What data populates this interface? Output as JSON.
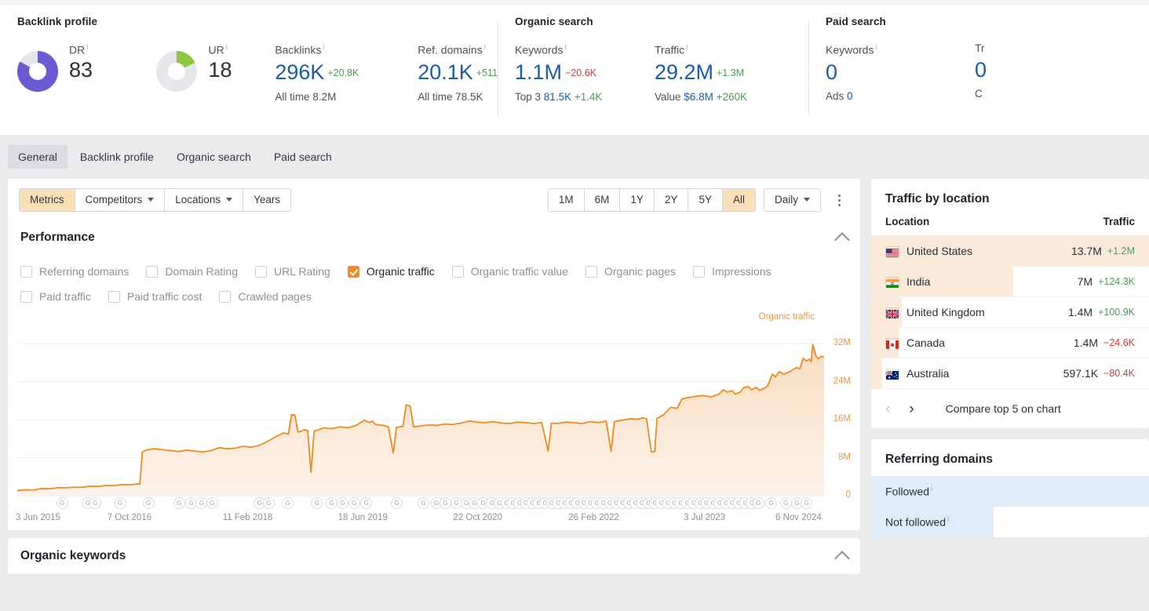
{
  "header": {
    "groups": [
      {
        "title": "Backlink profile",
        "gauges": [
          {
            "label": "DR",
            "value": "83",
            "pct": 83,
            "color": "#6b5bd2"
          },
          {
            "label": "UR",
            "value": "18",
            "pct": 18,
            "color": "#8cc63e"
          }
        ],
        "metrics": [
          {
            "label": "Backlinks",
            "value": "296K",
            "delta": "+20.8K",
            "delta_dir": "up",
            "sub_label": "All time",
            "sub_value": "8.2M"
          },
          {
            "label": "Ref. domains",
            "value": "20.1K",
            "delta": "+511",
            "delta_dir": "up",
            "sub_label": "All time",
            "sub_value": "78.5K"
          }
        ]
      },
      {
        "title": "Organic search",
        "metrics": [
          {
            "label": "Keywords",
            "value": "1.1M",
            "delta": "−20.6K",
            "delta_dir": "down",
            "sub_label": "Top 3",
            "sub_value": "81.5K",
            "sub_delta": "+1.4K",
            "sub_delta_dir": "up"
          },
          {
            "label": "Traffic",
            "value": "29.2M",
            "delta": "+1.3M",
            "delta_dir": "up",
            "sub_label": "Value",
            "sub_value": "$6.8M",
            "sub_delta": "+260K",
            "sub_delta_dir": "up"
          }
        ]
      },
      {
        "title": "Paid search",
        "metrics": [
          {
            "label": "Keywords",
            "value": "0",
            "sub_label": "Ads",
            "sub_value": "0"
          },
          {
            "label": "Tr",
            "value": "0",
            "sub_label": "C",
            "sub_value": ""
          }
        ]
      }
    ]
  },
  "tabs": [
    {
      "label": "General",
      "active": true
    },
    {
      "label": "Backlink profile",
      "active": false
    },
    {
      "label": "Organic search",
      "active": false
    },
    {
      "label": "Paid search",
      "active": false
    }
  ],
  "toolbar": {
    "left_buttons": [
      {
        "label": "Metrics",
        "selected": true,
        "caret": false
      },
      {
        "label": "Competitors",
        "selected": false,
        "caret": true
      },
      {
        "label": "Locations",
        "selected": false,
        "caret": true
      },
      {
        "label": "Years",
        "selected": false,
        "caret": false
      }
    ],
    "ranges": [
      {
        "label": "1M",
        "selected": false
      },
      {
        "label": "6M",
        "selected": false
      },
      {
        "label": "1Y",
        "selected": false
      },
      {
        "label": "2Y",
        "selected": false
      },
      {
        "label": "5Y",
        "selected": false
      },
      {
        "label": "All",
        "selected": true
      }
    ],
    "granularity": "Daily",
    "more_menu": "more-options"
  },
  "performance": {
    "title": "Performance",
    "metrics_row1": [
      {
        "label": "Referring domains",
        "checked": false
      },
      {
        "label": "Domain Rating",
        "checked": false
      },
      {
        "label": "URL Rating",
        "checked": false
      },
      {
        "label": "Organic traffic",
        "checked": true
      },
      {
        "label": "Organic traffic value",
        "checked": false
      },
      {
        "label": "Organic pages",
        "checked": false
      },
      {
        "label": "Impressions",
        "checked": false
      }
    ],
    "metrics_row2": [
      {
        "label": "Paid traffic",
        "checked": false
      },
      {
        "label": "Paid traffic cost",
        "checked": false
      },
      {
        "label": "Crawled pages",
        "checked": false
      }
    ]
  },
  "organic_keywords": {
    "title": "Organic keywords"
  },
  "chart_data": {
    "type": "area",
    "title": "Organic traffic",
    "legend": "Organic traffic",
    "legend_position": "top-right",
    "xlabel": "",
    "ylabel": "Organic traffic",
    "grid": true,
    "line_color": "#f08a1e",
    "fill_color": "#fbe6cf",
    "ylim": [
      0,
      36000000
    ],
    "ytick_labels": [
      "0",
      "8M",
      "16M",
      "24M",
      "32M"
    ],
    "ytick_values": [
      0,
      8000000,
      16000000,
      24000000,
      32000000
    ],
    "xtick_labels": [
      "3 Jun 2015",
      "7 Oct 2016",
      "11 Feb 2018",
      "18 Jun 2019",
      "22 Oct 2020",
      "26 Feb 2022",
      "3 Jul 2023",
      "6 Nov 2024"
    ],
    "series": [
      {
        "name": "Organic traffic",
        "points": [
          [
            0.0,
            1100000
          ],
          [
            0.01,
            1250000
          ],
          [
            0.02,
            1200000
          ],
          [
            0.03,
            1500000
          ],
          [
            0.04,
            1450000
          ],
          [
            0.05,
            1700000
          ],
          [
            0.06,
            1650000
          ],
          [
            0.07,
            1800000
          ],
          [
            0.08,
            1750000
          ],
          [
            0.09,
            2000000
          ],
          [
            0.1,
            1950000
          ],
          [
            0.11,
            2150000
          ],
          [
            0.12,
            2100000
          ],
          [
            0.13,
            2350000
          ],
          [
            0.14,
            2300000
          ],
          [
            0.15,
            2500000
          ],
          [
            0.152,
            2450000
          ],
          [
            0.155,
            9200000
          ],
          [
            0.16,
            9600000
          ],
          [
            0.17,
            9900000
          ],
          [
            0.18,
            9700000
          ],
          [
            0.19,
            9500000
          ],
          [
            0.2,
            9300000
          ],
          [
            0.21,
            9600000
          ],
          [
            0.22,
            9400000
          ],
          [
            0.23,
            9200000
          ],
          [
            0.24,
            9500000
          ],
          [
            0.25,
            10100000
          ],
          [
            0.26,
            9900000
          ],
          [
            0.27,
            10000000
          ],
          [
            0.28,
            10400000
          ],
          [
            0.29,
            10200000
          ],
          [
            0.3,
            10600000
          ],
          [
            0.31,
            11400000
          ],
          [
            0.32,
            12400000
          ],
          [
            0.33,
            13200000
          ],
          [
            0.336,
            13000000
          ],
          [
            0.34,
            17100000
          ],
          [
            0.344,
            17000000
          ],
          [
            0.348,
            13400000
          ],
          [
            0.352,
            13600000
          ],
          [
            0.356,
            13900000
          ],
          [
            0.36,
            13700000
          ],
          [
            0.364,
            4900000
          ],
          [
            0.368,
            13600000
          ],
          [
            0.372,
            13800000
          ],
          [
            0.38,
            14300000
          ],
          [
            0.39,
            14100000
          ],
          [
            0.4,
            14500000
          ],
          [
            0.41,
            14300000
          ],
          [
            0.42,
            14800000
          ],
          [
            0.43,
            15900000
          ],
          [
            0.436,
            15400000
          ],
          [
            0.44,
            15700000
          ],
          [
            0.444,
            15000000
          ],
          [
            0.45,
            14900000
          ],
          [
            0.456,
            14700000
          ],
          [
            0.46,
            14500000
          ],
          [
            0.466,
            9000000
          ],
          [
            0.47,
            14400000
          ],
          [
            0.478,
            14600000
          ],
          [
            0.482,
            19100000
          ],
          [
            0.487,
            18900000
          ],
          [
            0.491,
            14500000
          ],
          [
            0.5,
            14700000
          ],
          [
            0.51,
            14900000
          ],
          [
            0.52,
            14800000
          ],
          [
            0.53,
            15100000
          ],
          [
            0.54,
            15000000
          ],
          [
            0.55,
            15300000
          ],
          [
            0.56,
            15700000
          ],
          [
            0.57,
            15500000
          ],
          [
            0.58,
            15400000
          ],
          [
            0.59,
            15600000
          ],
          [
            0.6,
            15300000
          ],
          [
            0.61,
            15200000
          ],
          [
            0.62,
            15500000
          ],
          [
            0.63,
            15400000
          ],
          [
            0.64,
            15200000
          ],
          [
            0.65,
            15400000
          ],
          [
            0.658,
            9400000
          ],
          [
            0.662,
            15300000
          ],
          [
            0.67,
            15200000
          ],
          [
            0.68,
            15500000
          ],
          [
            0.69,
            15400000
          ],
          [
            0.7,
            15200000
          ],
          [
            0.71,
            15600000
          ],
          [
            0.72,
            15400000
          ],
          [
            0.73,
            15700000
          ],
          [
            0.736,
            9300000
          ],
          [
            0.74,
            15600000
          ],
          [
            0.75,
            15900000
          ],
          [
            0.76,
            16200000
          ],
          [
            0.77,
            16100000
          ],
          [
            0.775,
            16400000
          ],
          [
            0.78,
            16200000
          ],
          [
            0.786,
            9200000
          ],
          [
            0.79,
            9300000
          ],
          [
            0.793,
            16300000
          ],
          [
            0.8,
            16900000
          ],
          [
            0.81,
            18600000
          ],
          [
            0.818,
            18400000
          ],
          [
            0.824,
            20400000
          ],
          [
            0.83,
            20600000
          ],
          [
            0.84,
            20900000
          ],
          [
            0.85,
            21100000
          ],
          [
            0.86,
            20800000
          ],
          [
            0.87,
            21400000
          ],
          [
            0.875,
            22300000
          ],
          [
            0.88,
            21800000
          ],
          [
            0.886,
            22100000
          ],
          [
            0.89,
            21400000
          ],
          [
            0.896,
            21800000
          ],
          [
            0.9,
            22700000
          ],
          [
            0.906,
            23000000
          ],
          [
            0.91,
            22300000
          ],
          [
            0.916,
            22800000
          ],
          [
            0.92,
            22200000
          ],
          [
            0.926,
            22600000
          ],
          [
            0.93,
            23100000
          ],
          [
            0.936,
            25600000
          ],
          [
            0.94,
            25000000
          ],
          [
            0.944,
            26100000
          ],
          [
            0.95,
            25600000
          ],
          [
            0.956,
            26000000
          ],
          [
            0.96,
            26400000
          ],
          [
            0.966,
            27000000
          ],
          [
            0.97,
            26700000
          ],
          [
            0.974,
            28900000
          ],
          [
            0.978,
            28400000
          ],
          [
            0.982,
            28700000
          ],
          [
            0.984,
            28200000
          ],
          [
            0.986,
            31800000
          ],
          [
            0.988,
            30700000
          ],
          [
            0.99,
            29400000
          ],
          [
            0.993,
            28800000
          ],
          [
            0.996,
            29300000
          ],
          [
            1.0,
            29200000
          ]
        ]
      }
    ],
    "google_update_markers": "G"
  },
  "traffic_by_location": {
    "title": "Traffic by location",
    "columns": [
      "Location",
      "Traffic"
    ],
    "rows": [
      {
        "country": "United States",
        "flag": "us",
        "traffic": "13.7M",
        "delta": "+1.2M",
        "delta_dir": "up",
        "bar_pct": 100
      },
      {
        "country": "India",
        "flag": "in",
        "traffic": "7M",
        "delta": "+124.3K",
        "delta_dir": "up",
        "bar_pct": 51
      },
      {
        "country": "United Kingdom",
        "flag": "gb",
        "traffic": "1.4M",
        "delta": "+100.9K",
        "delta_dir": "up",
        "bar_pct": 11
      },
      {
        "country": "Canada",
        "flag": "ca",
        "traffic": "1.4M",
        "delta": "−24.6K",
        "delta_dir": "down",
        "bar_pct": 10
      },
      {
        "country": "Australia",
        "flag": "au",
        "traffic": "597.1K",
        "delta": "−80.4K",
        "delta_dir": "down",
        "bar_pct": 4
      }
    ],
    "pager_label": "Compare top 5 on chart"
  },
  "referring_domains": {
    "title": "Referring domains",
    "rows": [
      {
        "label": "Followed",
        "bar_pct": 100
      },
      {
        "label": "Not followed",
        "bar_pct": 44
      }
    ]
  }
}
